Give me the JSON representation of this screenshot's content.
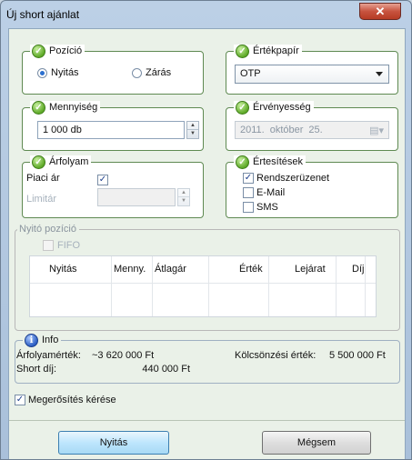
{
  "window": {
    "title": "Új short ajánlat",
    "close_label": "✕"
  },
  "pozicio": {
    "label": "Pozíció",
    "options": [
      "Nyitás",
      "Zárás"
    ],
    "selected": "Nyitás"
  },
  "ertekpapir": {
    "label": "Értékpapír",
    "value": "OTP"
  },
  "mennyiseg": {
    "label": "Mennyiség",
    "value": "1 000 db"
  },
  "ervenyesseg": {
    "label": "Érvényesség",
    "year": "2011.",
    "month": "október",
    "day": "25."
  },
  "arfolyam": {
    "label": "Árfolyam",
    "piaci_ar_label": "Piaci ár",
    "piaci_ar_checked": true,
    "limitar_label": "Limitár",
    "limitar_value": ""
  },
  "ertesitesek": {
    "label": "Értesítések",
    "items": [
      {
        "label": "Rendszerüzenet",
        "checked": true
      },
      {
        "label": "E-Mail",
        "checked": false
      },
      {
        "label": "SMS",
        "checked": false
      }
    ]
  },
  "nyito_pozicio": {
    "label": "Nyitó pozíció",
    "fifo_label": "FIFO",
    "columns": [
      "Nyitás",
      "Menny.",
      "Átlagár",
      "Érték",
      "Lejárat",
      "Díj"
    ]
  },
  "info": {
    "label": "Info",
    "arfolyamertek_label": "Árfolyamérték:",
    "arfolyamertek_value": "~3 620 000 Ft",
    "short_dij_label": "Short díj:",
    "short_dij_value": "440 000 Ft",
    "kolcsonzesi_label": "Kölcsönzési érték:",
    "kolcsonzesi_value": "5 500 000 Ft"
  },
  "megerosites": {
    "label": "Megerősítés kérése",
    "checked": true
  },
  "buttons": {
    "open_label": "Nyitás",
    "cancel_label": "Mégsem"
  }
}
